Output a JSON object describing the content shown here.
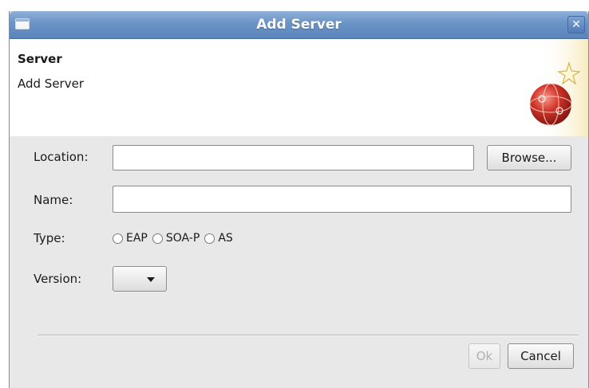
{
  "window": {
    "title": "Add Server",
    "close_glyph": "✕"
  },
  "header": {
    "title": "Server",
    "description": "Add Server",
    "icon": "server-globe-icon"
  },
  "form": {
    "location_label": "Location:",
    "location_value": "",
    "browse_label": "Browse...",
    "name_label": "Name:",
    "name_value": "",
    "type_label": "Type:",
    "type_options": [
      "EAP",
      "SOA-P",
      "AS"
    ],
    "version_label": "Version:",
    "version_value": ""
  },
  "buttons": {
    "ok_label": "Ok",
    "cancel_label": "Cancel"
  }
}
